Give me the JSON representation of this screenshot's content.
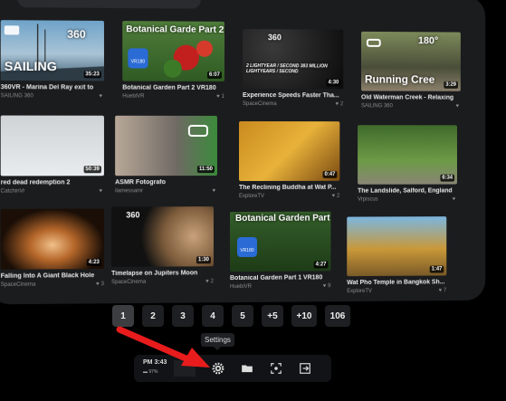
{
  "videos": [
    {
      "title": "360VR - Marina Del Ray exit to",
      "channel": "SAILING 360",
      "likes": "",
      "duration": "35:23",
      "overlay": "SAILING",
      "badge": "360"
    },
    {
      "title": "Botanical Garden Part 2 VR180",
      "channel": "HuebiVR",
      "likes": "1",
      "duration": "6:07",
      "overlay": "Botanical Garde Part 2",
      "badge": "VR180"
    },
    {
      "title": "Experience Speeds Faster Tha...",
      "channel": "SpaceCinema",
      "likes": "2",
      "duration": "4:30",
      "overlay": "2 LIGHTYEAR / SECOND  383 MILLION LIGHTYEARS / SECOND",
      "badge": "360"
    },
    {
      "title": "Old Waterman Creek - Relaxing",
      "channel": "SAILING 360",
      "likes": "",
      "duration": "3:29",
      "overlay": "Running Cree",
      "badge": "180°"
    },
    {
      "title": "red dead redemption 2",
      "channel": "CatchinVr",
      "likes": "",
      "duration": "50:39",
      "overlay": "",
      "badge": ""
    },
    {
      "title": "ASMR Fotografo",
      "channel": "ilamessamr",
      "likes": "",
      "duration": "11:50",
      "overlay": "",
      "badge": ""
    },
    {
      "title": "The Reclining Buddha at Wat P...",
      "channel": "ExploreTV",
      "likes": "2",
      "duration": "0:47",
      "overlay": "",
      "badge": ""
    },
    {
      "title": "The Landslide, Salford, England",
      "channel": "Vrpiscus",
      "likes": "",
      "duration": "6:34",
      "overlay": "",
      "badge": ""
    },
    {
      "title": "Falling Into A Giant Black Hole",
      "channel": "SpaceCinema",
      "likes": "3",
      "duration": "4:23",
      "overlay": "",
      "badge": ""
    },
    {
      "title": "Timelapse on Jupiters Moon",
      "channel": "SpaceCinema",
      "likes": "2",
      "duration": "1:30",
      "overlay": "",
      "badge": "360"
    },
    {
      "title": "Botanical Garden Part 1 VR180",
      "channel": "HuebiVR",
      "likes": "9",
      "duration": "4:27",
      "overlay": "Botanical Garden Part",
      "badge": "VR180"
    },
    {
      "title": "Wat Pho Temple in Bangkok Sh...",
      "channel": "ExploreTV",
      "likes": "7",
      "duration": "1:47",
      "overlay": "",
      "badge": ""
    }
  ],
  "pagination": [
    "1",
    "2",
    "3",
    "4",
    "5",
    "+5",
    "+10",
    "106"
  ],
  "status": {
    "time": "PM 3:43",
    "battery": "97%"
  },
  "tooltip": "Settings",
  "colors": {
    "accent": "#2a6bd6",
    "arrow": "#e81c1c"
  }
}
